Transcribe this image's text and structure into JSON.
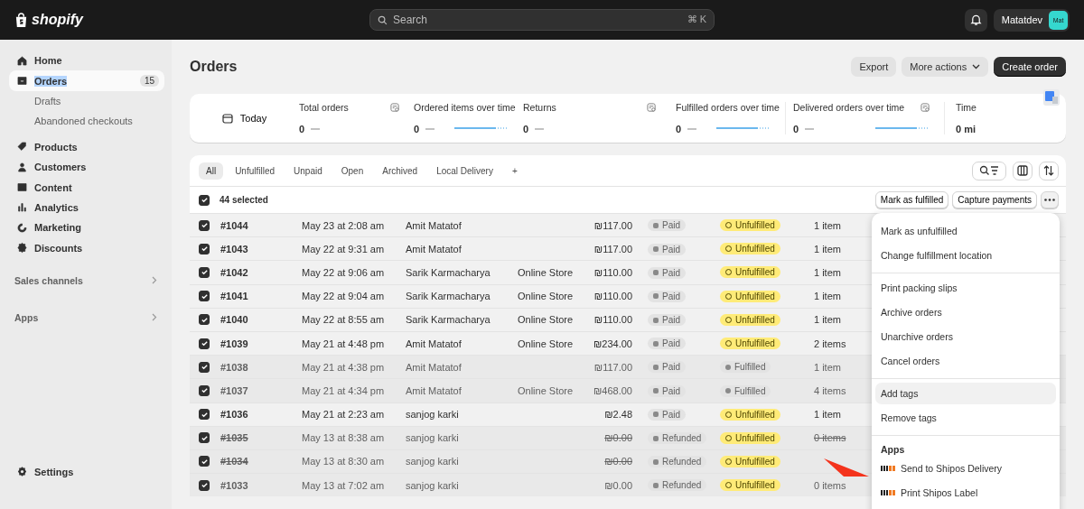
{
  "topbar": {
    "logo": "shopify",
    "search": {
      "placeholder": "Search",
      "shortcut": "⌘ K"
    },
    "account": {
      "name": "Matatdev",
      "initials": "Mat"
    }
  },
  "sidebar": {
    "items": [
      {
        "label": "Home",
        "selected": false
      },
      {
        "label": "Orders",
        "selected": true,
        "badge": "15",
        "children": [
          {
            "label": "Drafts",
            "selected": false
          },
          {
            "label": "Abandoned checkouts",
            "selected": false
          }
        ]
      },
      {
        "label": "Products",
        "selected": false
      },
      {
        "label": "Customers",
        "selected": false
      },
      {
        "label": "Content",
        "selected": false
      },
      {
        "label": "Analytics",
        "selected": false
      },
      {
        "label": "Marketing",
        "selected": false
      },
      {
        "label": "Discounts",
        "selected": false
      }
    ],
    "sections": [
      "Sales channels",
      "Apps"
    ],
    "settings": "Settings"
  },
  "page": {
    "title": "Orders",
    "actions": [
      {
        "label": "Export",
        "kind": "secondary"
      },
      {
        "label": "More actions",
        "kind": "dropdown"
      },
      {
        "label": "Create order",
        "kind": "primary"
      }
    ]
  },
  "metrics": {
    "date": "Today",
    "items": [
      {
        "label": "Total orders",
        "value": "0",
        "sparkline": false
      },
      {
        "label": "Ordered items over time",
        "value": "0",
        "sparkline": true
      },
      {
        "label": "Returns",
        "value": "0",
        "sparkline": false
      },
      {
        "label": "Fulfilled orders over time",
        "value": "0",
        "sparkline": true
      },
      {
        "label": "Delivered orders over time",
        "value": "0",
        "sparkline": true
      },
      {
        "label": "Time",
        "value": "0 mi",
        "sparkline": false
      }
    ]
  },
  "tabs": [
    {
      "label": "All",
      "selected": true
    },
    {
      "label": "Unfulfilled",
      "selected": false
    },
    {
      "label": "Unpaid",
      "selected": false
    },
    {
      "label": "Open",
      "selected": false
    },
    {
      "label": "Archived",
      "selected": false
    },
    {
      "label": "Local Delivery",
      "selected": false
    },
    {
      "label": "+",
      "selected": false
    }
  ],
  "selection": {
    "label": "44 selected",
    "checked": true,
    "actions": [
      "Mark as fulfilled",
      "Capture payments"
    ]
  },
  "rows": [
    {
      "order": "#1044",
      "date": "May 23 at 2:08 am",
      "customer": "Amit Matatof",
      "channel": "",
      "total": "₪117.00",
      "payment": "Paid",
      "fulfillment": "Unfulfilled",
      "items": "1 item",
      "selected": true,
      "archived": false,
      "cancelled": false
    },
    {
      "order": "#1043",
      "date": "May 22 at 9:31 am",
      "customer": "Amit Matatof",
      "channel": "",
      "total": "₪117.00",
      "payment": "Paid",
      "fulfillment": "Unfulfilled",
      "items": "1 item",
      "selected": true,
      "archived": false,
      "cancelled": false
    },
    {
      "order": "#1042",
      "date": "May 22 at 9:06 am",
      "customer": "Sarik Karmacharya",
      "channel": "Online Store",
      "total": "₪110.00",
      "payment": "Paid",
      "fulfillment": "Unfulfilled",
      "items": "1 item",
      "selected": true,
      "archived": false,
      "cancelled": false
    },
    {
      "order": "#1041",
      "date": "May 22 at 9:04 am",
      "customer": "Sarik Karmacharya",
      "channel": "Online Store",
      "total": "₪110.00",
      "payment": "Paid",
      "fulfillment": "Unfulfilled",
      "items": "1 item",
      "selected": true,
      "archived": false,
      "cancelled": false
    },
    {
      "order": "#1040",
      "date": "May 22 at 8:55 am",
      "customer": "Sarik Karmacharya",
      "channel": "Online Store",
      "total": "₪110.00",
      "payment": "Paid",
      "fulfillment": "Unfulfilled",
      "items": "1 item",
      "selected": true,
      "archived": false,
      "cancelled": false
    },
    {
      "order": "#1039",
      "date": "May 21 at 4:48 pm",
      "customer": "Amit Matatof",
      "channel": "Online Store",
      "total": "₪234.00",
      "payment": "Paid",
      "fulfillment": "Unfulfilled",
      "items": "2 items",
      "selected": true,
      "archived": false,
      "cancelled": false
    },
    {
      "order": "#1038",
      "date": "May 21 at 4:38 pm",
      "customer": "Amit Matatof",
      "channel": "",
      "total": "₪117.00",
      "payment": "Paid",
      "fulfillment": "Fulfilled",
      "items": "1 item",
      "selected": true,
      "archived": true,
      "cancelled": false
    },
    {
      "order": "#1037",
      "date": "May 21 at 4:34 pm",
      "customer": "Amit Matatof",
      "channel": "Online Store",
      "total": "₪468.00",
      "payment": "Paid",
      "fulfillment": "Fulfilled",
      "items": "4 items",
      "selected": true,
      "archived": true,
      "cancelled": false
    },
    {
      "order": "#1036",
      "date": "May 21 at 2:23 am",
      "customer": "sanjog karki",
      "channel": "",
      "total": "₪2.48",
      "payment": "Paid",
      "fulfillment": "Unfulfilled",
      "items": "1 item",
      "selected": true,
      "archived": false,
      "cancelled": false
    },
    {
      "order": "#1035",
      "date": "May 13 at 8:38 am",
      "customer": "sanjog karki",
      "channel": "",
      "total": "₪0.00",
      "payment": "Refunded",
      "fulfillment": "Unfulfilled",
      "items": "0 items",
      "selected": true,
      "archived": true,
      "cancelled": true
    },
    {
      "order": "#1034",
      "date": "May 13 at 8:30 am",
      "customer": "sanjog karki",
      "channel": "",
      "total": "₪0.00",
      "payment": "Refunded",
      "fulfillment": "Unfulfilled",
      "items": "",
      "selected": true,
      "archived": true,
      "cancelled": true
    },
    {
      "order": "#1033",
      "date": "May 13 at 7:02 am",
      "customer": "sanjog karki",
      "channel": "",
      "total": "₪0.00",
      "payment": "Refunded",
      "fulfillment": "Unfulfilled",
      "items": "0 items",
      "selected": true,
      "archived": true,
      "cancelled": false
    }
  ],
  "menu": {
    "groups": [
      {
        "items": [
          {
            "label": "Mark as unfulfilled",
            "selected": false
          },
          {
            "label": "Change fulfillment location",
            "selected": false
          }
        ]
      },
      {
        "items": [
          {
            "label": "Print packing slips",
            "selected": false
          },
          {
            "label": "Archive orders",
            "selected": false
          },
          {
            "label": "Unarchive orders",
            "selected": false
          },
          {
            "label": "Cancel orders",
            "selected": false
          }
        ]
      },
      {
        "items": [
          {
            "label": "Add tags",
            "selected": true
          },
          {
            "label": "Remove tags",
            "selected": false
          }
        ]
      },
      {
        "title": "Apps",
        "items": [
          {
            "label": "Send to Shipos Delivery",
            "selected": false,
            "kind": "app"
          },
          {
            "label": "Print Shipos Label",
            "selected": false,
            "kind": "app"
          }
        ]
      }
    ]
  }
}
